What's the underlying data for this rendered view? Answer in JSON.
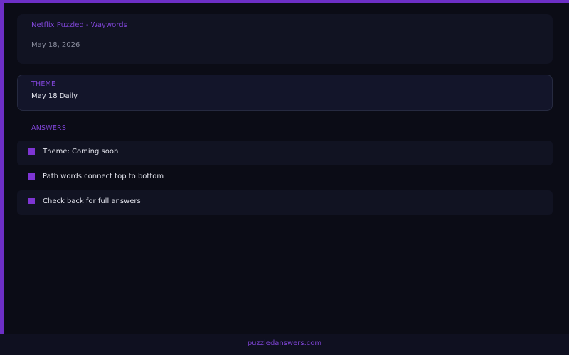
{
  "colors": {
    "accent": "#6d2fc6",
    "background": "#0b0c16",
    "card": "#111322",
    "theme_card": "#13152a",
    "label": "#7f45d6",
    "text": "#e2e3ec",
    "muted": "#8b8e9e"
  },
  "header": {
    "title": "Netflix Puzzled - Waywords",
    "date": "May 18, 2026"
  },
  "theme": {
    "label": "THEME",
    "value": "May 18 Daily"
  },
  "answers": {
    "label": "ANSWERS",
    "bullet_icon": "square-bullet-icon",
    "items": [
      {
        "text": "Theme: Coming soon"
      },
      {
        "text": "Path words connect top to bottom"
      },
      {
        "text": "Check back for full answers"
      }
    ]
  },
  "footer": {
    "link": "puzzledanswers.com"
  }
}
